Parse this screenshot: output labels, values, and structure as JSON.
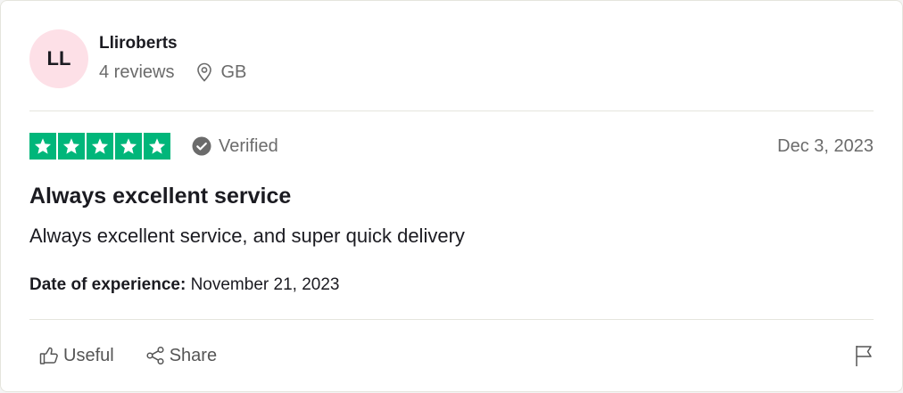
{
  "consumer": {
    "initials": "LL",
    "name": "Lliroberts",
    "reviews_count": "4 reviews",
    "country": "GB"
  },
  "review": {
    "rating": 5,
    "verified_label": "Verified",
    "date_posted": "Dec 3, 2023",
    "title": "Always excellent service",
    "text": "Always excellent service, and super quick delivery",
    "experience_label": "Date of experience:",
    "experience_date": "November 21, 2023"
  },
  "actions": {
    "useful_label": "Useful",
    "share_label": "Share"
  },
  "icons": {
    "location": "location-pin-icon",
    "verified": "check-circle-icon",
    "useful": "thumbs-up-icon",
    "share": "share-icon",
    "report": "flag-icon",
    "star": "star-icon"
  },
  "colors": {
    "star_green": "#00b67a",
    "avatar_bg": "#fde0e7",
    "muted_text": "#6b6b6b",
    "divider": "#e5e5dd"
  }
}
